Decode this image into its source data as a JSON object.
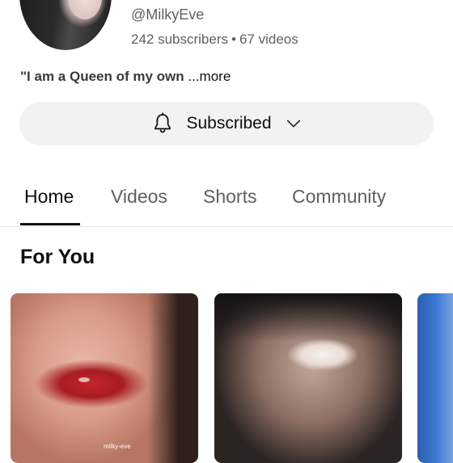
{
  "channel": {
    "handle": "@MilkyEve",
    "subscribers": "242 subscribers",
    "separator": "•",
    "videos": "67 videos",
    "description": "\"I am a Queen of my own",
    "more_label": "...more"
  },
  "subscribe": {
    "label": "Subscribed",
    "bell_icon": "bell-icon",
    "chevron_icon": "chevron-down-icon"
  },
  "tabs": [
    {
      "label": "Home",
      "active": true
    },
    {
      "label": "Videos",
      "active": false
    },
    {
      "label": "Shorts",
      "active": false
    },
    {
      "label": "Community",
      "active": false
    }
  ],
  "section": {
    "title": "For You"
  },
  "thumbnails": [
    {
      "watermark": "milky-eve"
    },
    {
      "watermark": ""
    },
    {
      "watermark": ""
    }
  ],
  "colors": {
    "background": "#ffffff",
    "button_bg": "#f2f2f2",
    "secondary_text": "#606060",
    "primary_text": "#0f0f0f"
  }
}
